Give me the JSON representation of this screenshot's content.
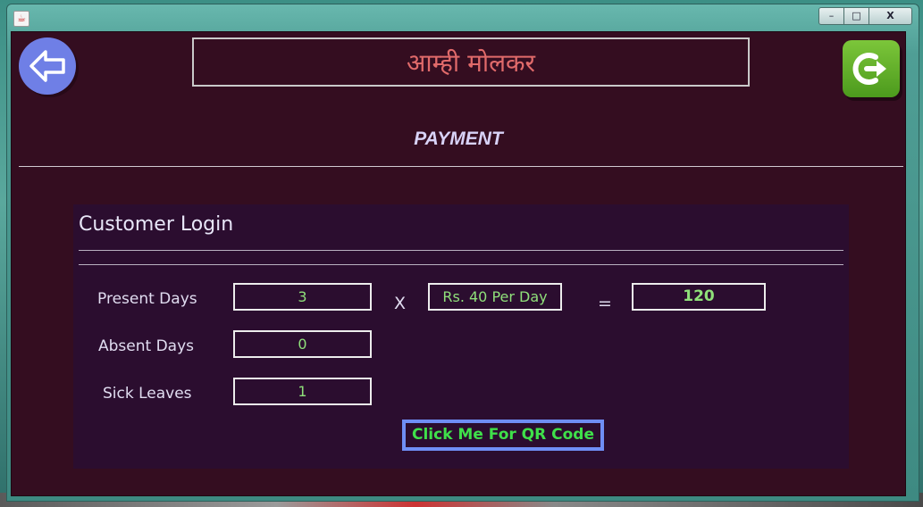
{
  "title_banner": "आम्ही मोलकर",
  "page_heading": "PAYMENT",
  "panel": {
    "title": "Customer Login",
    "rows": {
      "present_label": "Present Days",
      "present_value": "3",
      "absent_label": "Absent Days",
      "absent_value": "0",
      "sick_label": "Sick Leaves",
      "sick_value": "1"
    },
    "multiply_symbol": "X",
    "rate_value": "Rs. 40 Per Day",
    "equals_symbol": "=",
    "total_value": "120",
    "qr_button_label": "Click Me For QR Code"
  },
  "window_controls": {
    "minimize": "–",
    "maximize": "□",
    "close": "X"
  },
  "icons": {
    "back": "back-arrow-icon",
    "exit": "exit-icon",
    "app": "java-icon"
  },
  "colors": {
    "background": "#340d20",
    "panel": "#2b0d2f",
    "title_text": "#e06a6a",
    "heading_text": "#d8d2f7",
    "field_text": "#8fe07a",
    "qr_text": "#3fe04a",
    "qr_border": "#6f8ef5",
    "back_button": "#6f7fe6",
    "exit_button": "#5aa826"
  }
}
